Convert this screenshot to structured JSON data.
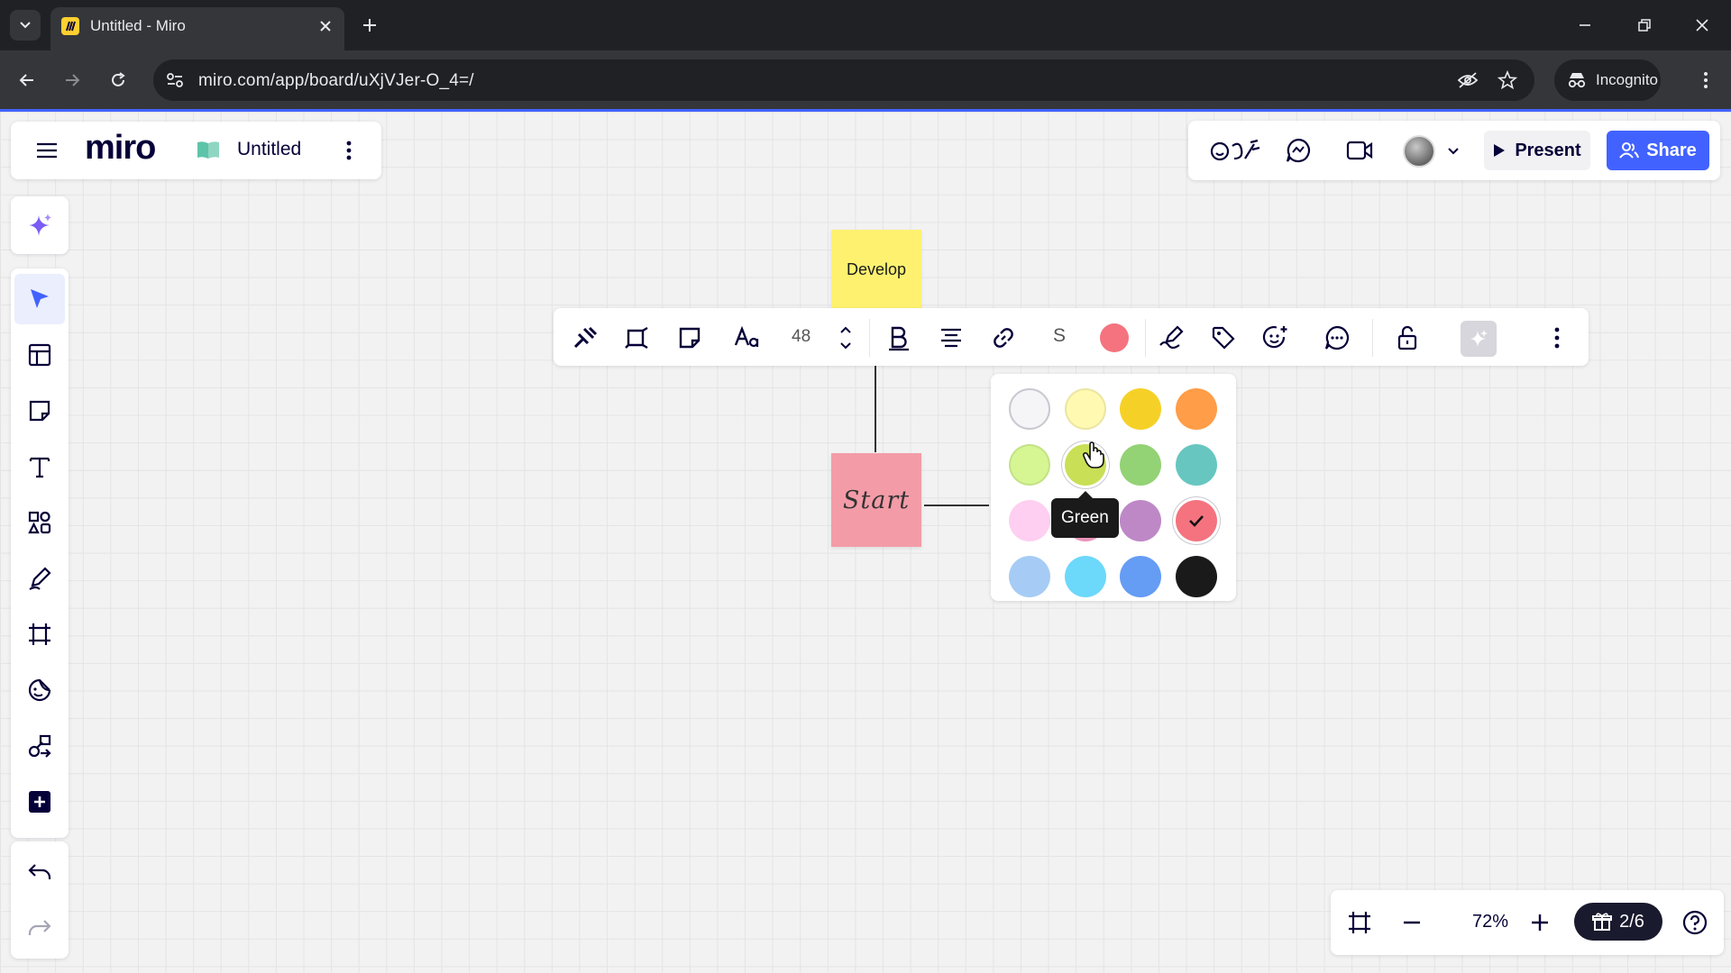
{
  "browser": {
    "tab_title": "Untitled - Miro",
    "url": "miro.com/app/board/uXjVJer-O_4=/",
    "incognito_label": "Incognito"
  },
  "board": {
    "logo": "miro",
    "title": "Untitled"
  },
  "collab": {
    "present_label": "Present",
    "share_label": "Share"
  },
  "tools": [
    "ai-sparkle-icon",
    "select-icon",
    "templates-icon",
    "sticky-note-icon",
    "text-icon",
    "shapes-icon",
    "pen-icon",
    "frame-icon",
    "stickers-icon",
    "shapes-lines-icon",
    "add-apps-icon"
  ],
  "stickies": {
    "develop": "Develop",
    "start": "Start"
  },
  "context_toolbar": {
    "font_size": "48",
    "strike": "S",
    "current_color": "#f4737f"
  },
  "color_picker": {
    "tooltip": "Green",
    "hovered": "Green",
    "selected": "#f4737f",
    "colors": [
      [
        "#f5f5f7",
        "#fff9b1",
        "#f5d128",
        "#ff9d48"
      ],
      [
        "#d5f692",
        "#c9df56",
        "#93d275",
        "#67c6c0"
      ],
      [
        "#fecff1",
        "#ea94bb",
        "#be88c7",
        "#f4737f"
      ],
      [
        "#a6ccf5",
        "#6cd8fa",
        "#659cf4",
        "#1a1a1a"
      ]
    ]
  },
  "zoom": {
    "level": "72%",
    "pages": "2/6"
  }
}
